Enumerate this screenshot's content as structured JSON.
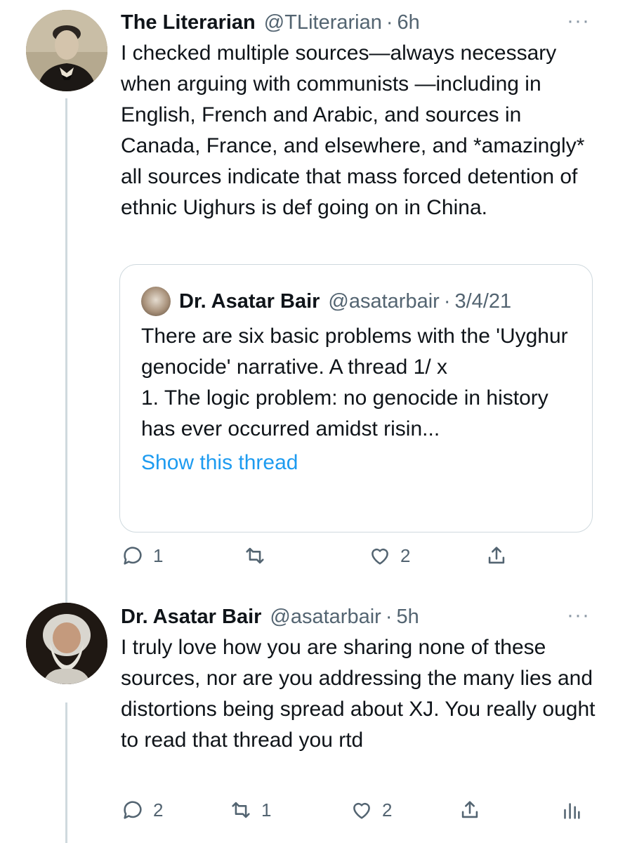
{
  "tweet1": {
    "name": "The Literarian",
    "handle": "@TLiterarian",
    "time": "6h",
    "more": "···",
    "text": "I checked multiple sources—always necessary when arguing with communists —including in English, French and Arabic, and sources in Canada, France, and elsewhere, and *amazingly* all sources indicate that mass forced detention of ethnic Uighurs is def going on in China.",
    "quote": {
      "name": "Dr. Asatar Bair",
      "handle": "@asatarbair",
      "time": "3/4/21",
      "text": "There are six basic problems with the 'Uyghur genocide' narrative. A thread 1/ x\n1. The logic problem: no genocide in history has ever occurred amidst risin...",
      "link": "Show this thread"
    },
    "actions": {
      "reply_count": "1",
      "retweet_count": "",
      "like_count": "2"
    }
  },
  "tweet2": {
    "name": "Dr. Asatar Bair",
    "handle": "@asatarbair",
    "time": "5h",
    "more": "···",
    "text": "I truly love how you are sharing none of these sources, nor are you addressing the many lies and distortions being spread about XJ. You really ought to read that thread you rtd",
    "actions": {
      "reply_count": "2",
      "retweet_count": "1",
      "like_count": "2"
    }
  },
  "colors": {
    "accent": "#1d9bf0",
    "muted": "#536471",
    "border": "#cfd9de"
  },
  "icons": [
    "reply-icon",
    "retweet-icon",
    "like-icon",
    "share-icon",
    "analytics-icon",
    "more-icon"
  ]
}
